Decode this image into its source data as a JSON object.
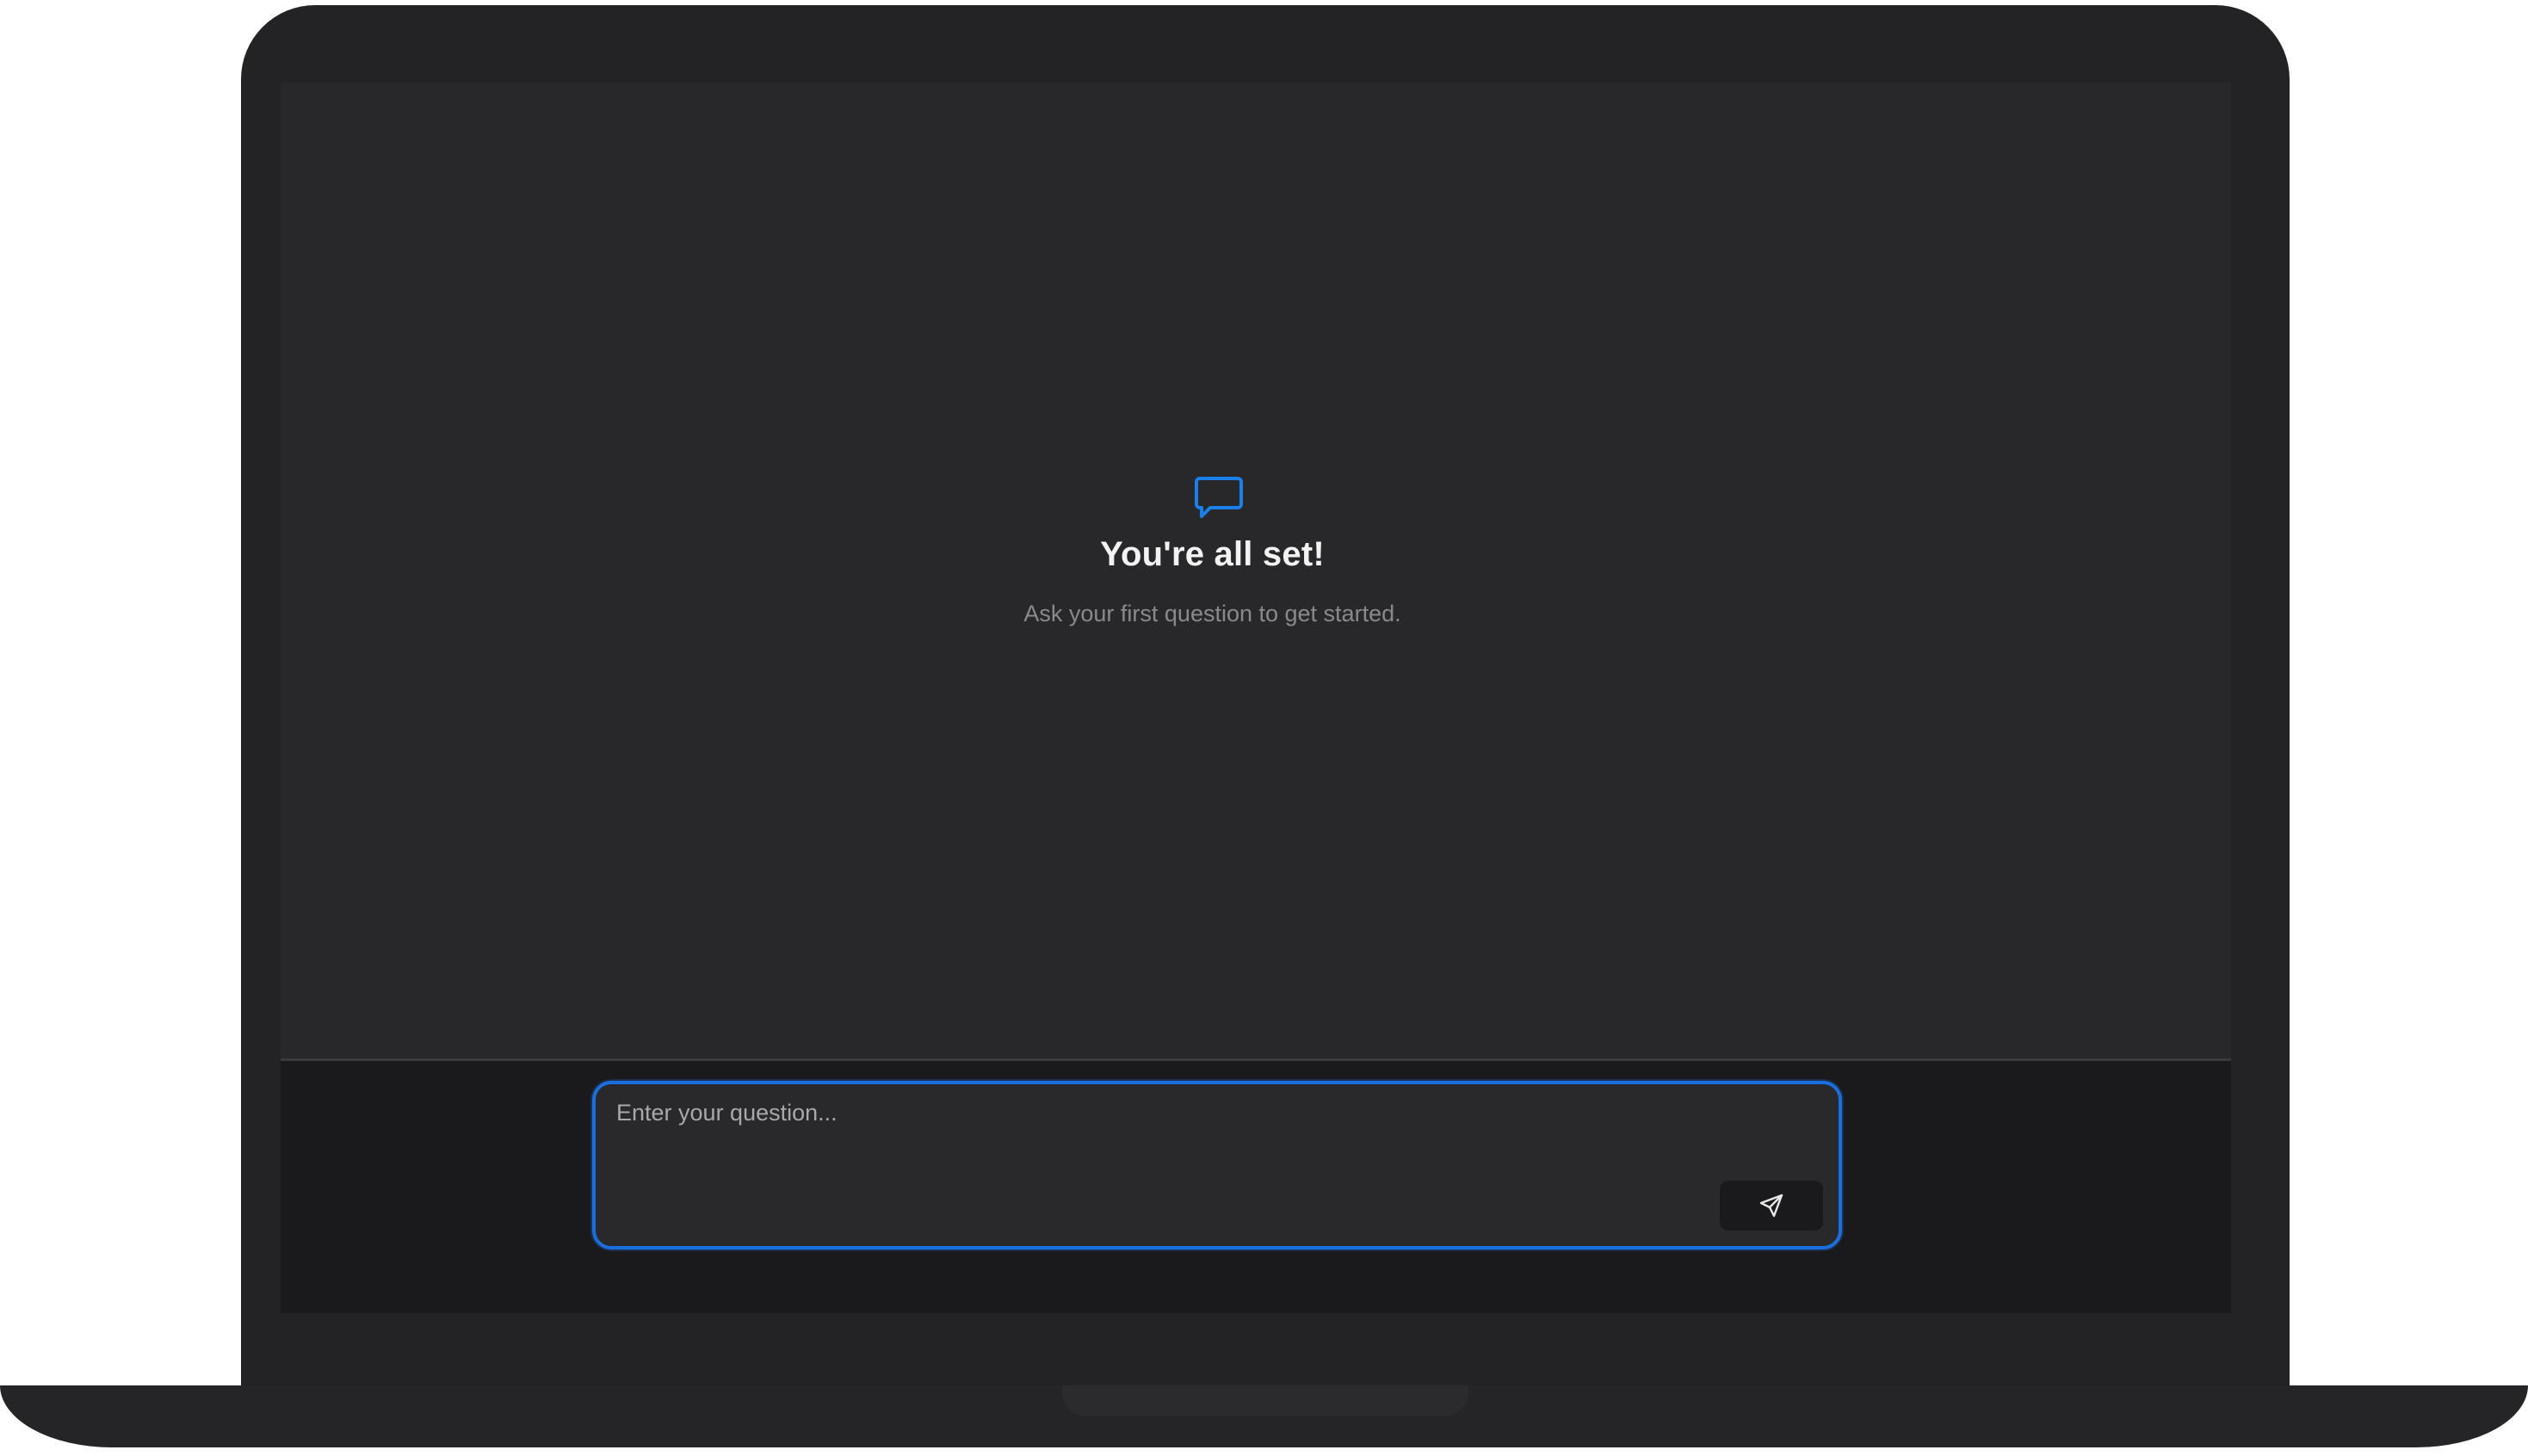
{
  "empty_state": {
    "icon": "chat-bubble-icon",
    "title": "You're all set!",
    "subtitle": "Ask your first question to get started."
  },
  "composer": {
    "placeholder": "Enter your question...",
    "value": "",
    "send_icon": "send-icon"
  },
  "colors": {
    "accent": "#1a6fe0",
    "screen_bg": "#28282a",
    "composer_bg": "#1a1a1c",
    "bezel": "#232325"
  }
}
